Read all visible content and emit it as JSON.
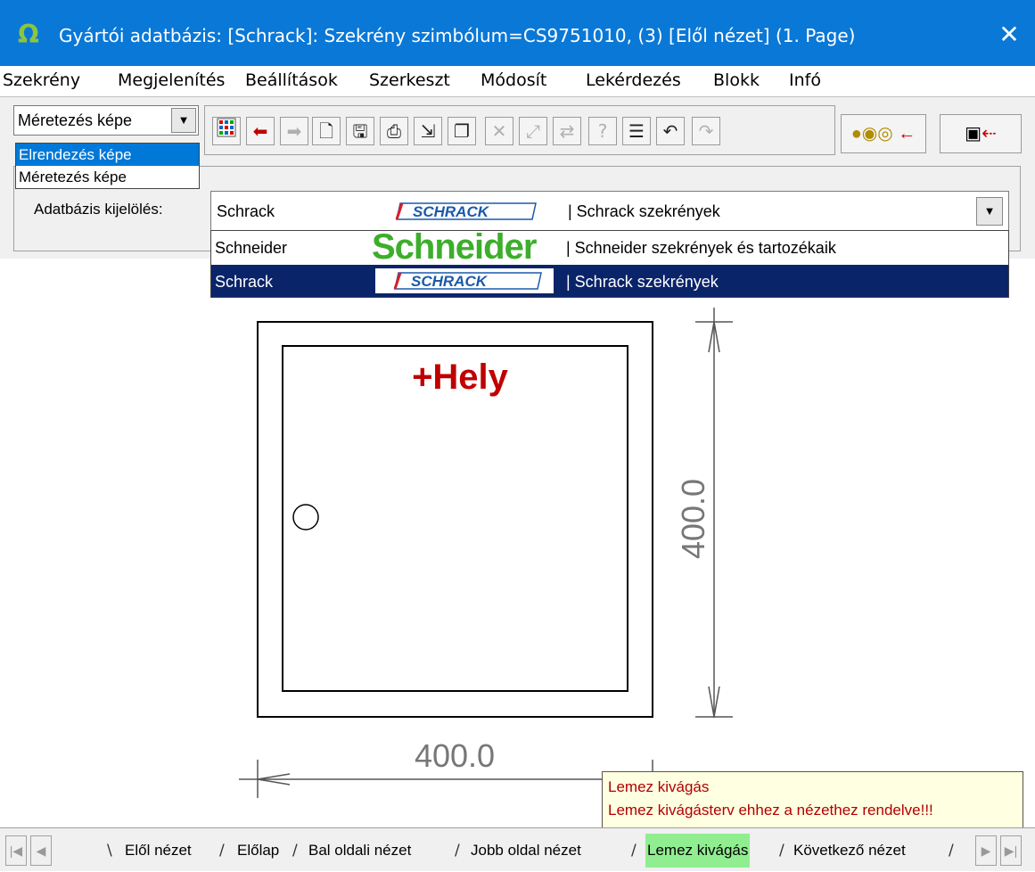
{
  "window": {
    "title": "Gyártói adatbázis: [Schrack]: Szekrény szimbólum=CS9751010, (3) [Elől nézet] (1. Page)",
    "app_icon": "Ω",
    "close_icon": "✕"
  },
  "menu": [
    "Szekrény",
    "Megjelenítés",
    "Beállítások",
    "Szerkeszt",
    "Módosít",
    "Lekérdezés",
    "Blokk",
    "Infó"
  ],
  "view_combo": {
    "value": "Méretezés képe",
    "options": [
      "Elrendezés képe",
      "Méretezés képe"
    ],
    "highlighted": "Elrendezés képe"
  },
  "toolbar": {
    "icons": [
      "grid-icon",
      "arrow-left-icon",
      "arrow-right-icon",
      "new-page-icon",
      "save-icon",
      "print-icon",
      "export-icon",
      "copy-icon",
      "delete-icon",
      "move-icon",
      "swap-icon",
      "help-icon",
      "list-icon",
      "undo-icon",
      "redo-icon",
      "coins-icon",
      "component-icon"
    ]
  },
  "db_select": {
    "label": "Adatbázis kijelölés:",
    "current": {
      "name": "Schrack",
      "logo": "SCHRACK",
      "desc": "| Schrack szekrények"
    },
    "options": [
      {
        "name": "Schneider",
        "logo": "Schneider",
        "desc": "| Schneider szekrények és tartozékaik"
      },
      {
        "name": "Schrack",
        "logo": "SCHRACK",
        "desc": "| Schrack szekrények"
      }
    ],
    "brand_colors": {
      "schneider": "#3dae2b",
      "schrack": "#1b5aa8",
      "schrack_red": "#d81e2a"
    }
  },
  "drawing": {
    "place_label": "+Hely",
    "width_dim": "400.0",
    "height_dim": "400.0"
  },
  "tooltip": {
    "line1": "Lemez kivágás",
    "line2": "Lemez kivágásterv ehhez a nézethez rendelve!!!"
  },
  "tabs": [
    {
      "label": "Elől nézet",
      "active": true
    },
    {
      "label": "Előlap"
    },
    {
      "label": "Bal oldali nézet"
    },
    {
      "label": "Jobb oldal nézet"
    },
    {
      "label": "Lemez kivágás",
      "highlight": true
    },
    {
      "label": "Következő nézet"
    }
  ]
}
